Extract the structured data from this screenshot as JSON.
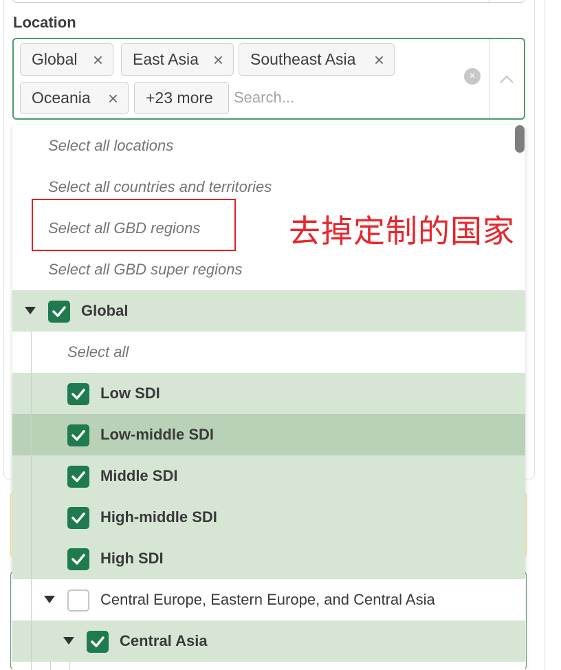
{
  "location_label": "Location",
  "chips": [
    {
      "label": "Global",
      "remove": "×"
    },
    {
      "label": "East Asia",
      "remove": "×"
    },
    {
      "label": "Southeast Asia",
      "remove": "×"
    },
    {
      "label": "Oceania",
      "remove": "×"
    }
  ],
  "more_chip": "+23 more",
  "search": {
    "placeholder": "Search...",
    "value": ""
  },
  "clear_glyph": "×",
  "select_actions": [
    "Select all locations",
    "Select all countries and territories",
    "Select all GBD regions",
    "Select all GBD super regions"
  ],
  "tree": {
    "global": {
      "label": "Global",
      "checked": true
    },
    "select_all": "Select all",
    "sdi": [
      {
        "label": "Low SDI",
        "checked": true
      },
      {
        "label": "Low-middle SDI",
        "checked": true
      },
      {
        "label": "Middle SDI",
        "checked": true
      },
      {
        "label": "High-middle SDI",
        "checked": true
      },
      {
        "label": "High SDI",
        "checked": true
      }
    ],
    "super_region": {
      "label": "Central Europe, Eastern Europe, and Central Asia",
      "checked": false
    },
    "region": {
      "label": "Central Asia",
      "checked": true
    }
  },
  "annotation": "去掉定制的国家",
  "colors": {
    "accent_green": "#1f7a4d",
    "selected_row": "#d6e5d4",
    "hover_row": "#b9d2b7",
    "annotation_red": "#e02020"
  },
  "icons": [
    "close-icon",
    "clear-circle-icon",
    "chevron-up-icon",
    "caret-down-icon",
    "checkbox-checked-icon",
    "checkbox-empty-icon"
  ]
}
